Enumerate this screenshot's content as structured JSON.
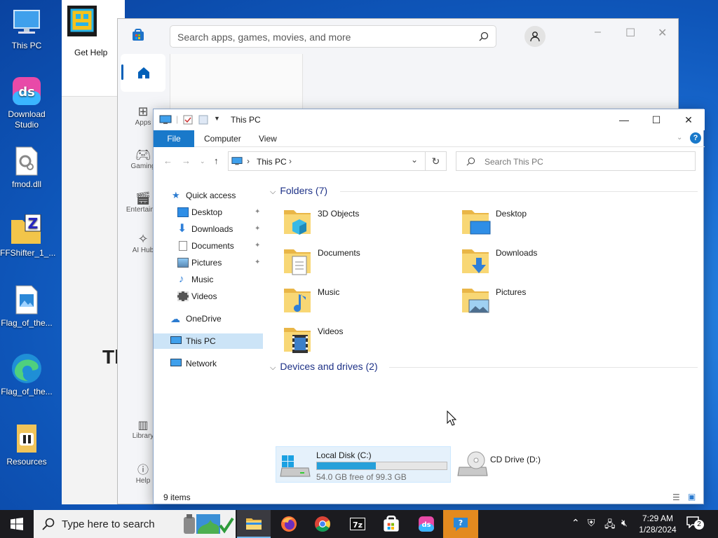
{
  "desktop_icons": [
    {
      "label": "This PC"
    },
    {
      "label": "Download Studio"
    },
    {
      "label": "fmod.dll"
    },
    {
      "label": "FFShifter_1_..."
    },
    {
      "label": "Flag_of_the..."
    },
    {
      "label": "Flag_of_the..."
    },
    {
      "label": "Resources"
    }
  ],
  "get_help": {
    "label": "Get Help",
    "big_text": "Th"
  },
  "store": {
    "search_placeholder": "Search apps, games, movies, and more",
    "rail": [
      "Apps",
      "Gaming",
      "Entertainm",
      "AI Hub",
      "Library",
      "Help"
    ]
  },
  "explorer": {
    "title": "This PC",
    "ribbon": {
      "file": "File",
      "computer": "Computer",
      "view": "View"
    },
    "address_path": "This PC",
    "search_placeholder": "Search This PC",
    "nav": {
      "quick_access": "Quick access",
      "items": [
        "Desktop",
        "Downloads",
        "Documents",
        "Pictures",
        "Music",
        "Videos"
      ],
      "onedrive": "OneDrive",
      "this_pc": "This PC",
      "network": "Network"
    },
    "folders_header": "Folders (7)",
    "folders": [
      "3D Objects",
      "Desktop",
      "Documents",
      "Downloads",
      "Music",
      "Pictures",
      "Videos"
    ],
    "drives_header": "Devices and drives (2)",
    "drive_c": {
      "name": "Local Disk (C:)",
      "free": "54.0 GB free of 99.3 GB",
      "used_fraction": 0.456
    },
    "drive_d": {
      "name": "CD Drive (D:)"
    },
    "status": "9 items"
  },
  "taskbar": {
    "search_placeholder": "Type here to search",
    "time": "7:29 AM",
    "date": "1/28/2024",
    "notifications": "2"
  },
  "colors": {
    "accent": "#1979ca",
    "selection": "#cce4f7",
    "drive_bar": "#26a0da",
    "taskbar": "#1b1b1f"
  }
}
